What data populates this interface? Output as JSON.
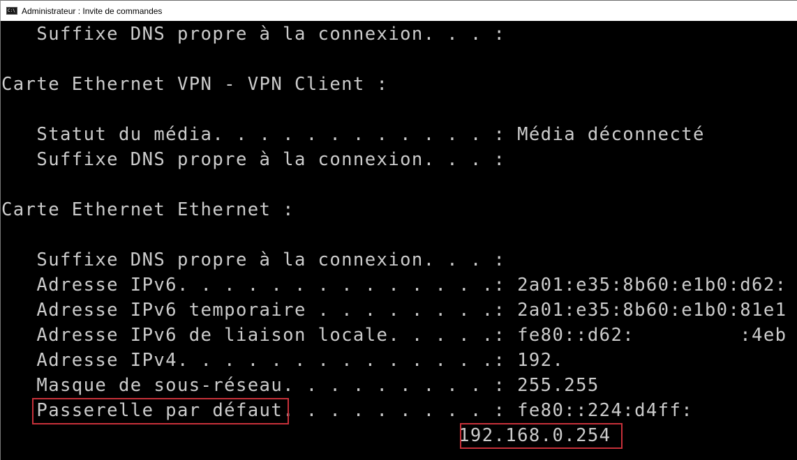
{
  "window": {
    "title": "Administrateur : Invite de commandes",
    "icon": "cmd-icon"
  },
  "console": {
    "lines": [
      "   Suffixe DNS propre à la connexion. . . :",
      "",
      "Carte Ethernet VPN - VPN Client :",
      "",
      "   Statut du média. . . . . . . . . . . . : Média déconnecté",
      "   Suffixe DNS propre à la connexion. . . :",
      "",
      "Carte Ethernet Ethernet :",
      "",
      "   Suffixe DNS propre à la connexion. . . :",
      "   Adresse IPv6. . . . . . . . . . . . . .: 2a01:e35:8b60:e1b0:d62:",
      "   Adresse IPv6 temporaire . . . . . . . .: 2a01:e35:8b60:e1b0:81e1",
      "   Adresse IPv6 de liaison locale. . . . .: fe80::d62:         :4eb",
      "   Adresse IPv4. . . . . . . . . . . . . .: 192.",
      "   Masque de sous-réseau. . . . . . . . . : 255.255",
      "   Passerelle par défaut. . . . . . . . . : fe80::224:d4ff:",
      "                                       192.168.0.254"
    ]
  },
  "highlights": {
    "color": "#c8313a",
    "items": [
      {
        "label": "Passerelle par défaut"
      },
      {
        "label": "192.168.0.254"
      }
    ]
  }
}
